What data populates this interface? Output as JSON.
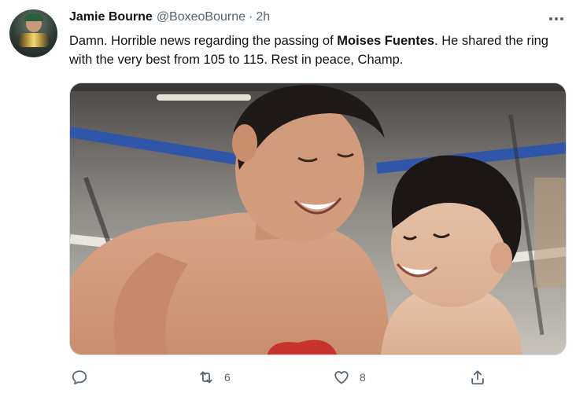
{
  "tweet": {
    "author_name": "Jamie Bourne",
    "author_handle": "@BoxeoBourne",
    "separator": "·",
    "time": "2h",
    "text_before": "Damn. Horrible news regarding the passing of ",
    "text_bold": "Moises Fuentes",
    "text_after": ". He shared the ring with the very best from 105 to 115. Rest in peace, Champ."
  },
  "actions": {
    "reply_icon": "reply-icon",
    "retweet_icon": "retweet-icon",
    "retweet_count": "6",
    "like_icon": "heart-icon",
    "like_count": "8",
    "share_icon": "share-icon"
  },
  "colors": {
    "text_primary": "#0f1419",
    "text_secondary": "#536471",
    "border": "#cfd9de"
  }
}
